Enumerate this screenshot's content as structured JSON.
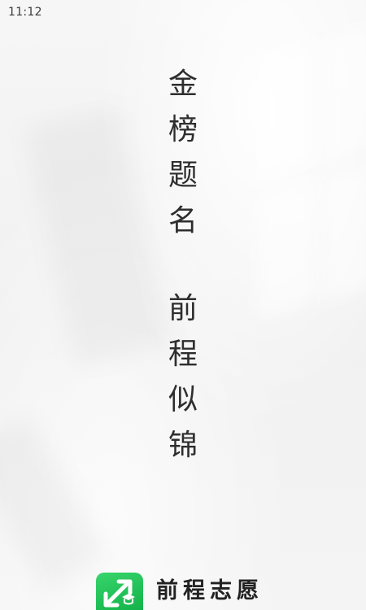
{
  "status_bar": {
    "time": "11:12"
  },
  "slogan": {
    "first": [
      "金",
      "榜",
      "题",
      "名"
    ],
    "second": [
      "前",
      "程",
      "似",
      "锦"
    ]
  },
  "brand": {
    "logo_icon": "graduation-arrow-logo-icon",
    "name": "前程志愿",
    "accent_color": "#1cc05a"
  },
  "colors": {
    "background": "#f4f4f4",
    "text": "#2e2e2e"
  }
}
